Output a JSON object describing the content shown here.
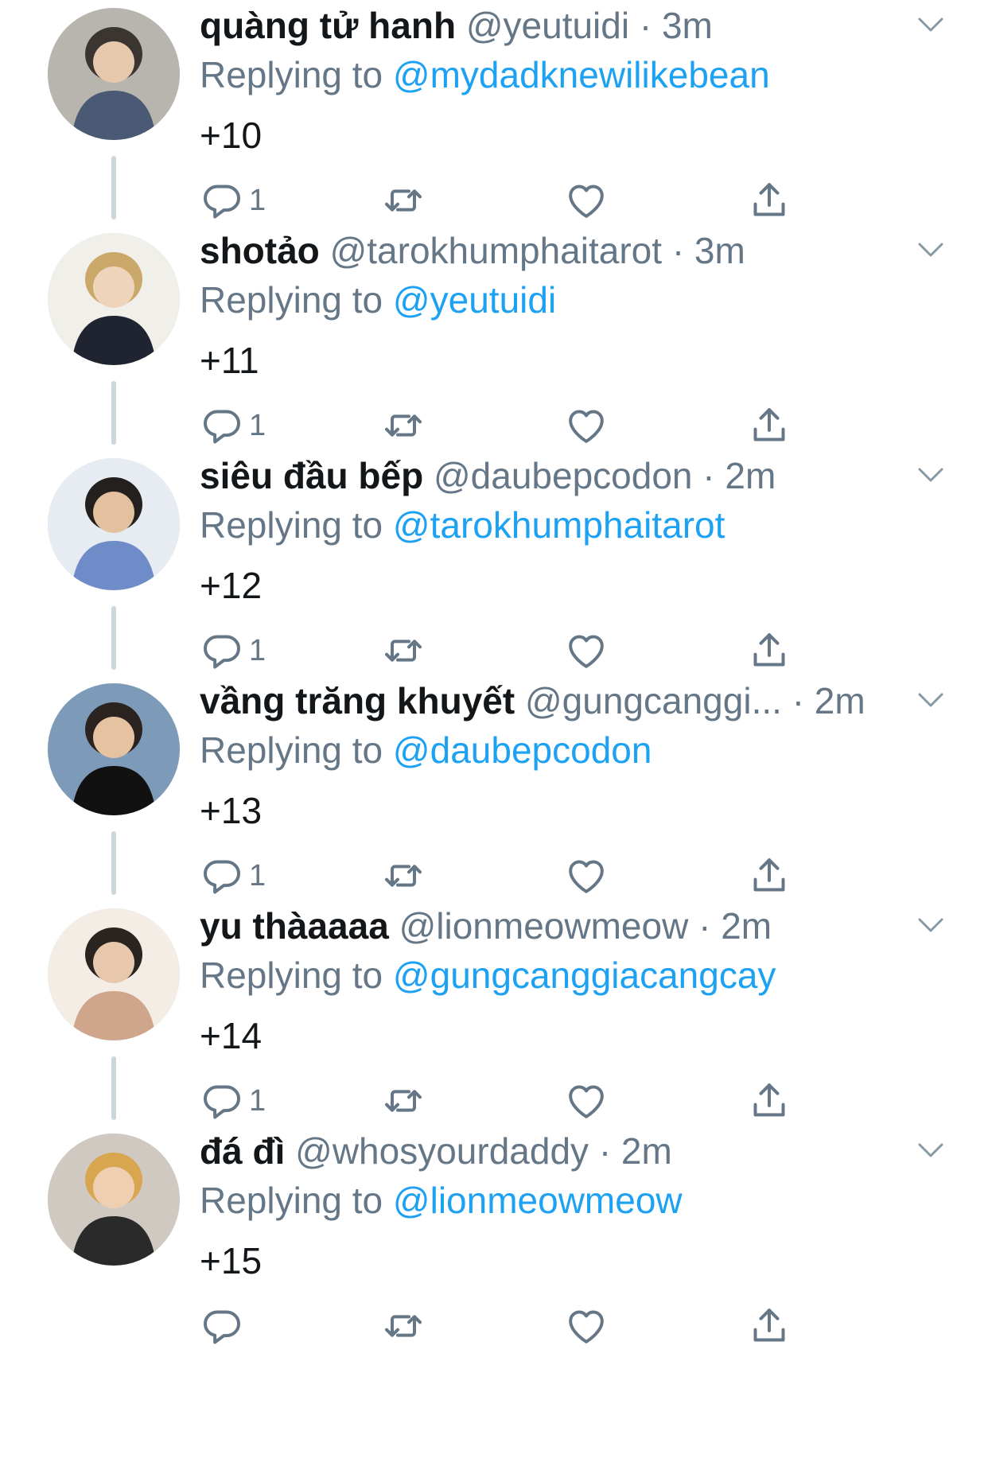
{
  "tweets": [
    {
      "name": "quàng tử hanh",
      "handle": "@yeutuidi",
      "dot": "·",
      "time": "3m",
      "replying_prefix": "Replying to",
      "replying_to": "@mydadknewilikebean",
      "text": "+10",
      "reply_count": "1"
    },
    {
      "name": "shotảo",
      "handle": "@tarokhumphaitarot",
      "dot": "·",
      "time": "3m",
      "replying_prefix": "Replying to",
      "replying_to": "@yeutuidi",
      "text": "+11",
      "reply_count": "1"
    },
    {
      "name": "siêu đầu bếp",
      "handle": "@daubepcodon",
      "dot": "·",
      "time": "2m",
      "replying_prefix": "Replying to",
      "replying_to": "@tarokhumphaitarot",
      "text": "+12",
      "reply_count": "1"
    },
    {
      "name": "vầng trăng khuyết",
      "handle": "@gungcanggi...",
      "dot": "·",
      "time": "2m",
      "replying_prefix": "Replying to",
      "replying_to": "@daubepcodon",
      "text": "+13",
      "reply_count": "1"
    },
    {
      "name": "yu thàaaaa",
      "handle": "@lionmeowmeow",
      "dot": "·",
      "time": "2m",
      "replying_prefix": "Replying to",
      "replying_to": "@gungcanggiacangcay",
      "text": "+14",
      "reply_count": "1"
    },
    {
      "name": "đá đì",
      "handle": "@whosyourdaddy",
      "dot": "·",
      "time": "2m",
      "replying_prefix": "Replying to",
      "replying_to": "@lionmeowmeow",
      "text": "+15",
      "reply_count": ""
    }
  ],
  "icons": {
    "reply": "reply-icon",
    "retweet": "retweet-icon",
    "like": "like-icon",
    "share": "share-icon",
    "more": "chevron-down-icon"
  },
  "colors": {
    "text": "#14171a",
    "secondary": "#657786",
    "accent": "#1da1f2",
    "thread_line": "#ccd6dd",
    "background": "#ffffff"
  }
}
